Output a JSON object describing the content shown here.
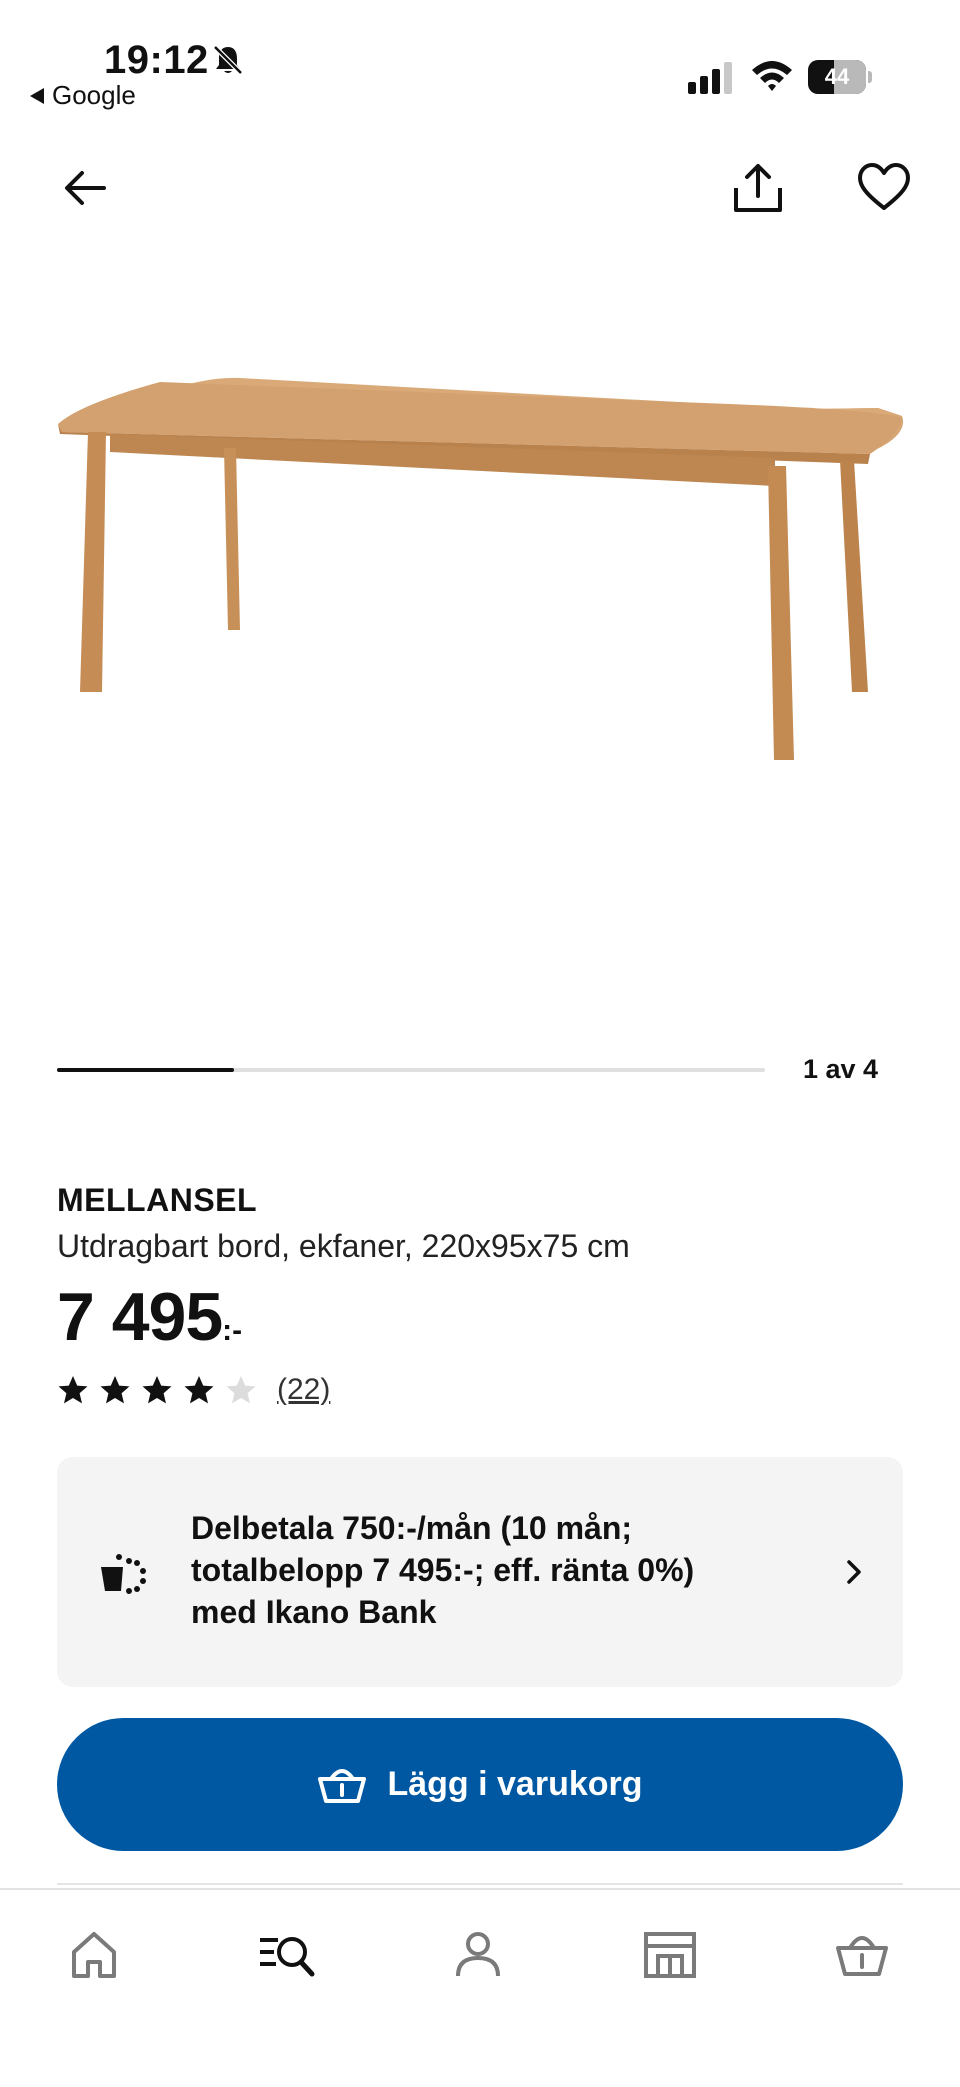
{
  "status_bar": {
    "time": "19:12",
    "back_app": "Google",
    "battery": "44",
    "battery_level": 0.44
  },
  "product": {
    "name": "MELLANSEL",
    "description": "Utdragbart bord, ekfaner, 220x95x75 cm",
    "price": "7 495",
    "price_suffix": ":-",
    "rating": 4,
    "rating_max": 5,
    "review_count": "(22)"
  },
  "gallery": {
    "indicator": "1 av 4",
    "current": 1,
    "total": 4
  },
  "finance": {
    "text": "Delbetala 750:-/mån (10 mån; totalbelopp 7 495:-; eff. ränta 0%) med Ikano Bank",
    "icon": "payment-icon"
  },
  "actions": {
    "add_to_cart": "Lägg i varukorg"
  },
  "tabs": [
    {
      "name": "home",
      "icon": "home-icon"
    },
    {
      "name": "search",
      "icon": "search-icon"
    },
    {
      "name": "profile",
      "icon": "person-icon"
    },
    {
      "name": "store",
      "icon": "store-icon"
    },
    {
      "name": "cart",
      "icon": "basket-icon"
    }
  ],
  "colors": {
    "brand_blue": "#0058a3",
    "panel_gray": "#f4f4f4",
    "wood": "#c8935c"
  }
}
